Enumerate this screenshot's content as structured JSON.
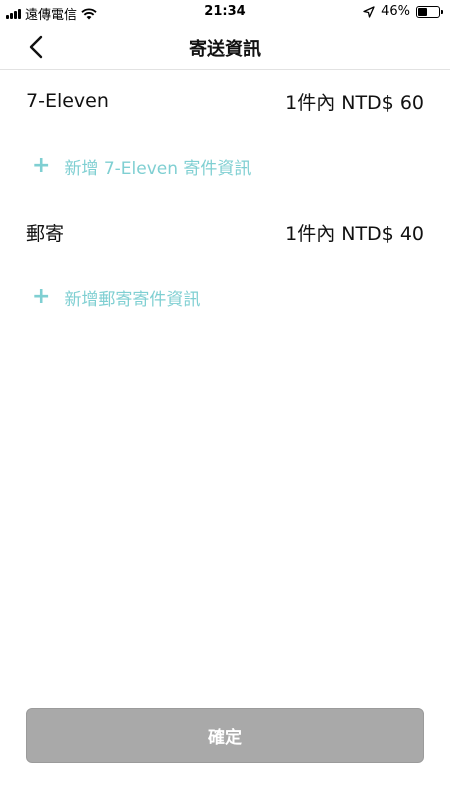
{
  "status_bar": {
    "carrier": "遠傳電信",
    "time": "21:34",
    "battery_text": "46%",
    "battery_level": 0.46,
    "icons": [
      "signal-icon",
      "wifi-icon",
      "location-arrow-icon",
      "battery-icon"
    ]
  },
  "nav": {
    "title": "寄送資訊",
    "back_icon": "chevron-left-icon"
  },
  "shipping_options": [
    {
      "name": "7-Eleven",
      "price": "1件內 NTD$ 60",
      "add_label": "新增 7-Eleven 寄件資訊"
    },
    {
      "name": "郵寄",
      "price": "1件內 NTD$ 40",
      "add_label": "新增郵寄寄件資訊"
    }
  ],
  "add_icon": "plus-icon",
  "confirm_label": "確定",
  "colors": {
    "accent": "#7fcfd2",
    "button_disabled": "#a9a9a9",
    "divider": "#e2e2e2"
  }
}
